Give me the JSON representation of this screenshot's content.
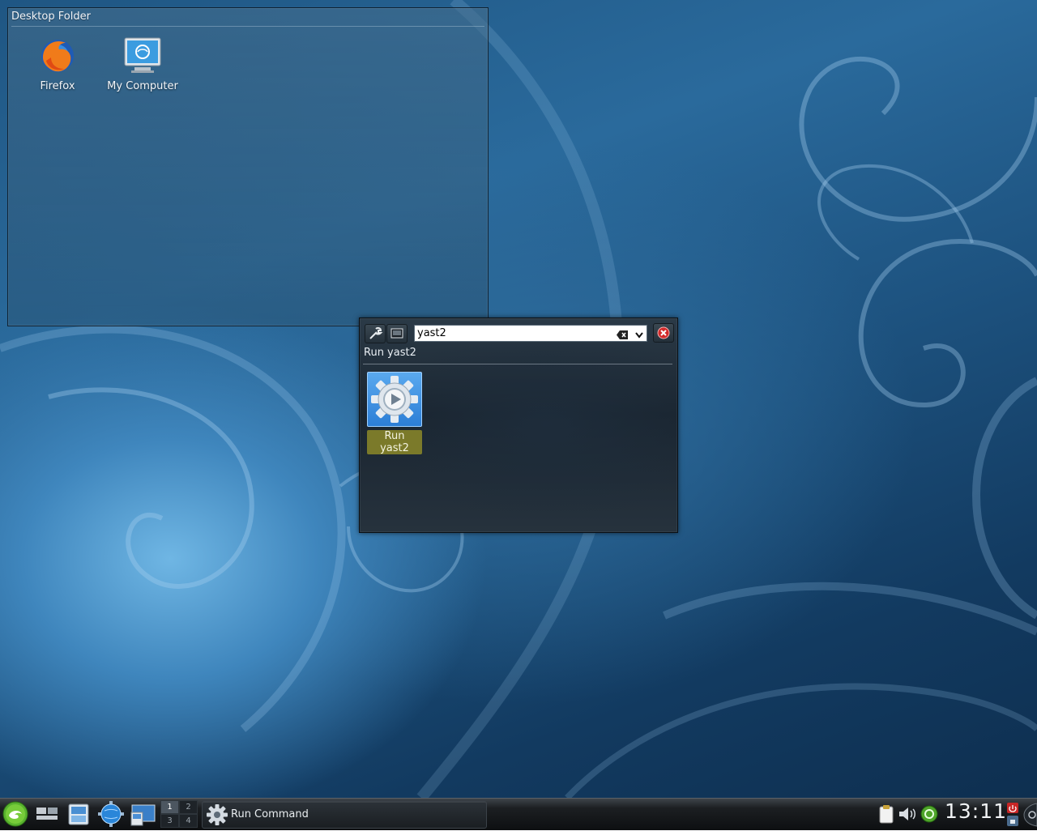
{
  "desktop_folder": {
    "title": "Desktop Folder",
    "icons": [
      {
        "label": "Firefox",
        "icon": "firefox-icon"
      },
      {
        "label": "My Computer",
        "icon": "computer-icon"
      }
    ]
  },
  "run_dialog": {
    "search_value": "yast2",
    "result_heading": "Run yast2",
    "results": [
      {
        "label": "Run yast2",
        "icon": "gear-run-icon",
        "selected": true
      }
    ]
  },
  "taskbar": {
    "launchers": [
      "opensuse-menu-icon",
      "show-desktop-icon",
      "file-manager-icon",
      "web-browser-icon",
      "system-monitor-icon"
    ],
    "pager": {
      "desktops": [
        "1",
        "2",
        "3",
        "4"
      ],
      "active": "1"
    },
    "tasks": [
      {
        "label": "Run Command",
        "icon": "gear-icon"
      }
    ],
    "systray": [
      "clipboard-icon",
      "volume-icon",
      "update-icon"
    ],
    "clock": "13:11"
  },
  "colors": {
    "wallpaper_accent": "#3f86bd",
    "selection_highlight": "#7b7a2a",
    "close_red": "#d22a2a"
  }
}
